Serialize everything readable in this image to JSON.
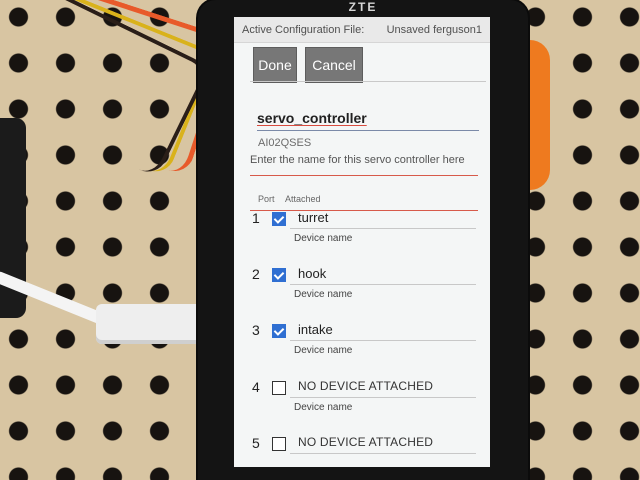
{
  "device_brand": "ZTE",
  "header": {
    "active_config_label": "Active Configuration File:",
    "active_config_value": "Unsaved ferguson1"
  },
  "buttons": {
    "done": "Done",
    "cancel": "Cancel"
  },
  "controller": {
    "name": "servo_controller",
    "serial": "AI02QSES",
    "hint": "Enter the name for this servo controller here"
  },
  "columns": {
    "port": "Port",
    "attached": "Attached"
  },
  "ports": [
    {
      "port": "1",
      "attached": true,
      "device": "turret",
      "label": "Device name"
    },
    {
      "port": "2",
      "attached": true,
      "device": "hook",
      "label": "Device name"
    },
    {
      "port": "3",
      "attached": true,
      "device": "intake",
      "label": "Device name"
    },
    {
      "port": "4",
      "attached": false,
      "device": "NO DEVICE ATTACHED",
      "label": "Device name"
    },
    {
      "port": "5",
      "attached": false,
      "device": "NO DEVICE ATTACHED",
      "label": ""
    }
  ],
  "colors": {
    "checkbox_on": "#2f6fd2",
    "accent_red": "#d75a4a",
    "button_gray": "#777777"
  }
}
